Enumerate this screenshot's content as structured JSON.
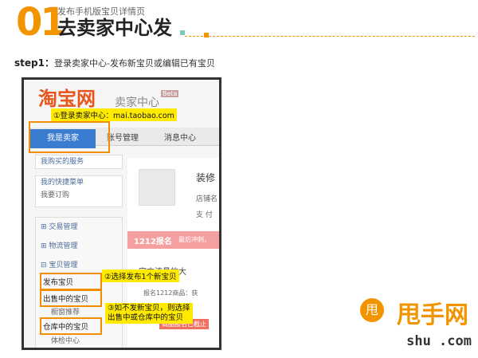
{
  "header": {
    "number": "01",
    "subtitle": "发布手机版宝贝详情页",
    "title": "去卖家中心发"
  },
  "step": {
    "label": "step1：",
    "text": "登录卖家中心-发布新宝贝或编辑已有宝贝"
  },
  "screenshot": {
    "logo": "淘宝网",
    "logo_suffix": "卖家中心",
    "beta": "Beta",
    "tabs": [
      "我是卖家",
      "账号管理",
      "消息中心"
    ],
    "sidebar_top": [
      "我购买的服务",
      "我的快捷菜单",
      "我要订购"
    ],
    "sidebar_sections": [
      "交易管理",
      "物流管理",
      "宝贝管理"
    ],
    "sidebar_items": [
      "发布宝贝",
      "出售中的宝贝",
      "橱窗推荐",
      "仓库中的宝贝",
      "体检中心"
    ],
    "right_title": "装修",
    "right_line1": "店铺名",
    "right_line2": "支 付",
    "banner": "1212报名",
    "banner_sub": "最后冲刺，",
    "promo": "官方流量的大",
    "promo2": "报名1212商品：获",
    "promo3": "商品报名已截止"
  },
  "callouts": {
    "c1": "①登录卖家中心：mai.taobao.com",
    "c2": "②选择发布1个新宝贝",
    "c3_line1": "③如不发新宝贝，则选择",
    "c3_line2": "出售中或仓库中的宝贝"
  },
  "watermark": {
    "brand": "甩手网",
    "domain": "shu   .com"
  },
  "colors": {
    "accent": "#f29400",
    "highlight": "#ffea00",
    "tab_active": "#3a7dd0"
  }
}
